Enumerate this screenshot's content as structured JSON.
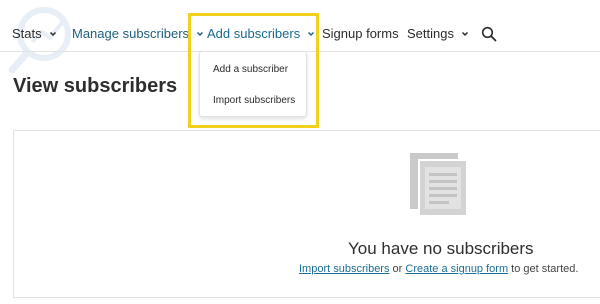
{
  "nav": {
    "stats": "Stats",
    "manage_subscribers": "Manage subscribers",
    "add_subscribers": "Add subscribers",
    "signup_forms": "Signup forms",
    "settings": "Settings"
  },
  "dropdown": {
    "items": [
      "Add a subscriber",
      "Import subscribers"
    ]
  },
  "page": {
    "title": "View subscribers"
  },
  "empty_state": {
    "title": "You have no subscribers",
    "link_import": "Import subscribers",
    "or_text": " or ",
    "link_create": "Create a signup form",
    "suffix": " to get started."
  },
  "colors": {
    "highlight": "#f2d11c",
    "link": "#1a6f96",
    "nav_teal": "#1f5f7a"
  },
  "icons": [
    "chevron-down-icon",
    "search-icon",
    "document-stack-icon"
  ]
}
